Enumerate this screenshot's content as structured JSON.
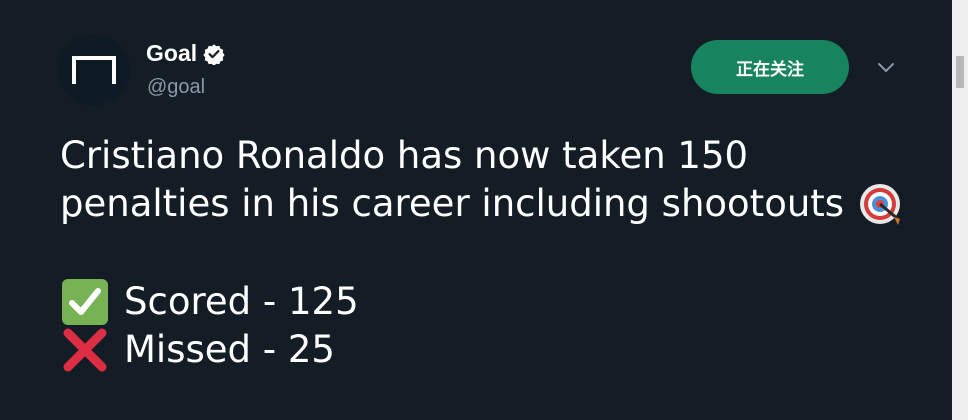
{
  "account": {
    "name": "Goal",
    "handle": "@goal",
    "verified": true,
    "avatar_icon": "goal-logo-icon"
  },
  "follow_button": {
    "label": "正在关注",
    "color": "#17845f"
  },
  "menu": {
    "icon": "chevron-down-icon"
  },
  "tweet": {
    "line1": "Cristiano Ronaldo has now taken 150",
    "line2": "penalties in his career including shootouts",
    "line2_icon": "direct-hit-target-icon",
    "scored_icon": "check-mark-button-icon",
    "scored_text": "Scored - 125",
    "missed_icon": "cross-mark-icon",
    "missed_text": "Missed - 25"
  },
  "colors": {
    "background": "#141d26",
    "handle": "#8899a6",
    "text": "#ffffff"
  }
}
